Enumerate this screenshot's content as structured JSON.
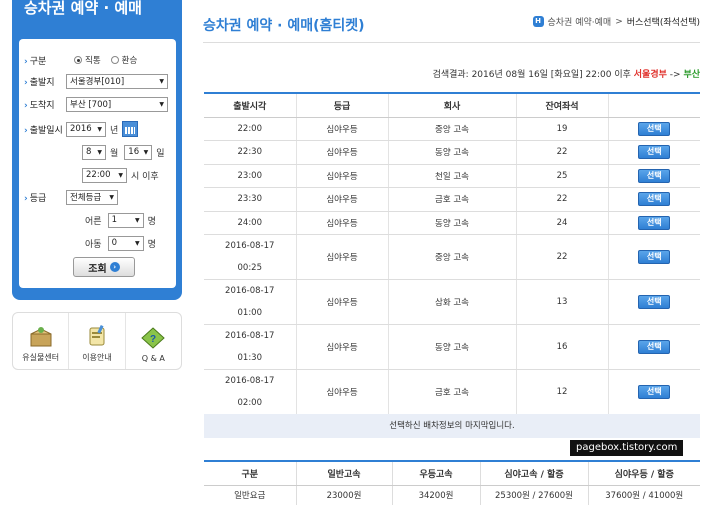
{
  "sidebar": {
    "title": "승차권 예약 · 예매",
    "trip_type": {
      "label": "구분",
      "options": [
        {
          "text": "직통",
          "selected": true
        },
        {
          "text": "환승",
          "selected": false
        }
      ]
    },
    "departure": {
      "label": "출발지",
      "value": "서울경부[010]"
    },
    "arrival": {
      "label": "도착지",
      "value": "부산 [700]"
    },
    "date": {
      "label": "출발일시",
      "year": "2016",
      "year_unit": "년",
      "month": "8",
      "month_unit": "월",
      "day": "16",
      "day_unit": "일",
      "time": "22:00",
      "time_unit": "시 이후"
    },
    "grade": {
      "label": "등급",
      "value": "전체등급"
    },
    "adult": {
      "label": "어른",
      "value": "1",
      "unit": "명"
    },
    "child": {
      "label": "아동",
      "value": "0",
      "unit": "명"
    },
    "search_button": "조회",
    "search_button_icon": "arrow-right-icon"
  },
  "quick_links": [
    {
      "label": "유실물센터",
      "icon": "lost-found-box-icon"
    },
    {
      "label": "이용안내",
      "icon": "guide-cup-icon"
    },
    {
      "label": "Q & A",
      "icon": "qa-diamond-icon"
    }
  ],
  "header": {
    "title": "승차권 예약 · 예매(홈티켓)",
    "breadcrumb": {
      "home_icon": "home-icon",
      "home": "H",
      "path": "승차권 예약·예매",
      "sep": ">",
      "current": "버스선택(좌석선택)"
    }
  },
  "search_result": {
    "prefix": "검색결과: 2016년 08월 16일 [화요일] 22:00 이후",
    "origin": "서울경부",
    "arrow": "->",
    "destination": "부산"
  },
  "results_table": {
    "columns": [
      "출발시각",
      "등급",
      "회사",
      "잔여좌석",
      ""
    ],
    "select_label": "선택",
    "rows": [
      {
        "time": "22:00",
        "grade": "심야우등",
        "company": "중앙 고속",
        "seats": "19"
      },
      {
        "time": "22:30",
        "grade": "심야우등",
        "company": "동양 고속",
        "seats": "22"
      },
      {
        "time": "23:00",
        "grade": "심야우등",
        "company": "천일 고속",
        "seats": "25"
      },
      {
        "time": "23:30",
        "grade": "심야우등",
        "company": "금호 고속",
        "seats": "22"
      },
      {
        "time": "24:00",
        "grade": "심야우등",
        "company": "동양 고속",
        "seats": "24"
      }
    ],
    "next_day_rows": [
      {
        "date": "2016-08-17",
        "time": "00:25",
        "grade": "심야우등",
        "company": "중앙 고속",
        "seats": "22"
      },
      {
        "date": "2016-08-17",
        "time": "01:00",
        "grade": "심야우등",
        "company": "삼화 고속",
        "seats": "13"
      },
      {
        "date": "2016-08-17",
        "time": "01:30",
        "grade": "심야우등",
        "company": "동양 고속",
        "seats": "16"
      },
      {
        "date": "2016-08-17",
        "time": "02:00",
        "grade": "심야우등",
        "company": "금호 고속",
        "seats": "12"
      }
    ],
    "end_note": "선택하신 배차정보의 마지막입니다."
  },
  "fare_table": {
    "columns": [
      "구분",
      "일반고속",
      "우등고속",
      "심야고속 / 할증",
      "심야우등 / 할증"
    ],
    "rows": [
      {
        "type": "일반요금",
        "normal": "23000원",
        "premium": "34200원",
        "night_normal": "25300원 / 27600원",
        "night_premium": "37600원 / 41000원"
      }
    ]
  },
  "watermark": "pagebox.tistory.com",
  "colors": {
    "accent": "#2f7fd4",
    "date_red": "#c8262a",
    "origin_red": "#e0322d",
    "destination_green": "#2a9a2a"
  }
}
